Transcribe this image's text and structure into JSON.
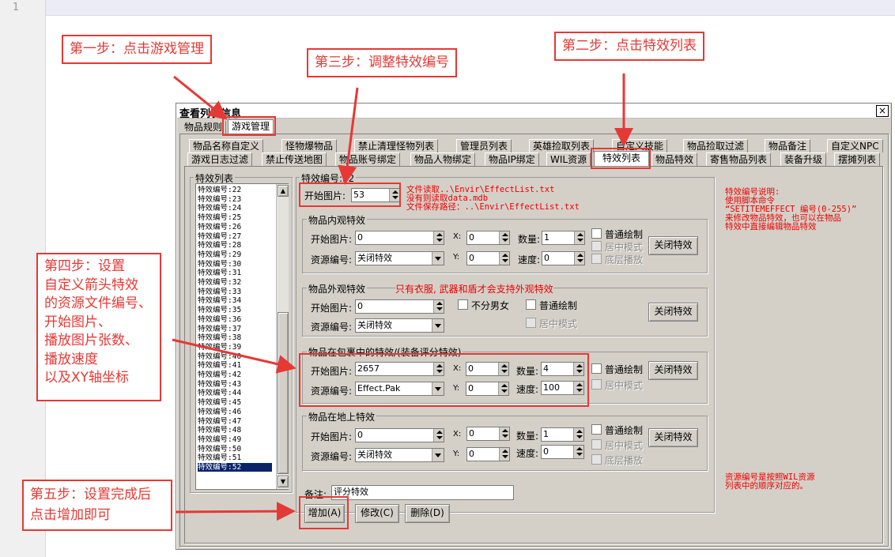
{
  "editor": {
    "line_number": "1"
  },
  "callouts": {
    "step1": "第一步：点击游戏管理",
    "step2": "第二步：点击特效列表",
    "step3": "第三步：调整特效编号",
    "step4": [
      "第四步：设置",
      "自定义箭头特效",
      "的资源文件编号、",
      "开始图片、",
      "播放图片张数、",
      "播放速度",
      "以及XY轴坐标"
    ],
    "step5": [
      "第五步：设置完成后",
      "点击增加即可"
    ]
  },
  "dialog": {
    "title": "查看列表信息",
    "close": "×",
    "top_tabs": [
      "物品规则",
      "游戏管理"
    ],
    "tabs_row1": [
      "物品名称自定义",
      "怪物爆物品",
      "禁止清理怪物列表",
      "管理员列表",
      "英雄捡取列表",
      "自定义技能",
      "物品捡取过滤",
      "物品备注",
      "自定义NPC"
    ],
    "tabs_row2": [
      "游戏日志过滤",
      "禁止传送地图",
      "物品账号绑定",
      "物品人物绑定",
      "物品IP绑定",
      "WIL资源",
      "特效列表",
      "物品特效",
      "寄售物品列表",
      "装备升级",
      "摆摊列表"
    ],
    "list": {
      "title": "特效列表",
      "prefix": "特效编号:",
      "items": [
        "22",
        "23",
        "24",
        "25",
        "26",
        "27",
        "28",
        "29",
        "30",
        "31",
        "32",
        "33",
        "34",
        "35",
        "36",
        "37",
        "38",
        "39",
        "40",
        "41",
        "42",
        "43",
        "44",
        "45",
        "46",
        "47",
        "48",
        "49",
        "50",
        "51",
        "52"
      ],
      "selected": "52"
    },
    "effect_group": "特效编号:52",
    "effect_no_label": "特效编号:",
    "effect_no": "53",
    "file_info": [
      "文件读取..\\Envir\\EffectList.txt",
      "没有则读取data.mdb",
      "文件保存路径：..\\Envir\\EffectList.txt"
    ],
    "explain": [
      "特效编号说明:",
      "使用脚本命令",
      "“SETITEMEFFECT  编号(0-255)”",
      "来修改物品特效，也可以在物品",
      "特效中直接编辑物品特效"
    ],
    "res_note": [
      "资源编号是按照WIL资源",
      "列表中的顺序对应的。"
    ],
    "labels": {
      "start": "开始图片:",
      "res": "资源编号:",
      "x": "X:",
      "y": "Y:",
      "count": "数量:",
      "speed": "速度:",
      "normal": "普通绘制",
      "center": "居中模式",
      "bottom": "底层播放",
      "gender": "不分男女",
      "close": "关闭特效"
    },
    "groups": {
      "inner": {
        "title": "物品内观特效",
        "start": "0",
        "res": "关闭特效",
        "x": "0",
        "y": "0",
        "count": "1",
        "speed": "0"
      },
      "outer": {
        "title": "物品外观特效",
        "note": "只有衣服, 武器和盾才会支持外观特效",
        "start": "0",
        "res": "关闭特效"
      },
      "bag": {
        "title": "物品在包裹中的特效/(装备评分特效)",
        "start": "2657",
        "res": "Effect.Pak",
        "x": "0",
        "y": "0",
        "count": "4",
        "speed": "100"
      },
      "ground": {
        "title": "物品在地上特效",
        "start": "0",
        "res": "关闭特效",
        "x": "0",
        "y": "0",
        "count": "1",
        "speed": "0"
      }
    },
    "remark_label": "备注:",
    "remark": "评分特效",
    "buttons": {
      "add": "增加(A)",
      "edit": "修改(C)",
      "delete": "删除(D)"
    }
  }
}
